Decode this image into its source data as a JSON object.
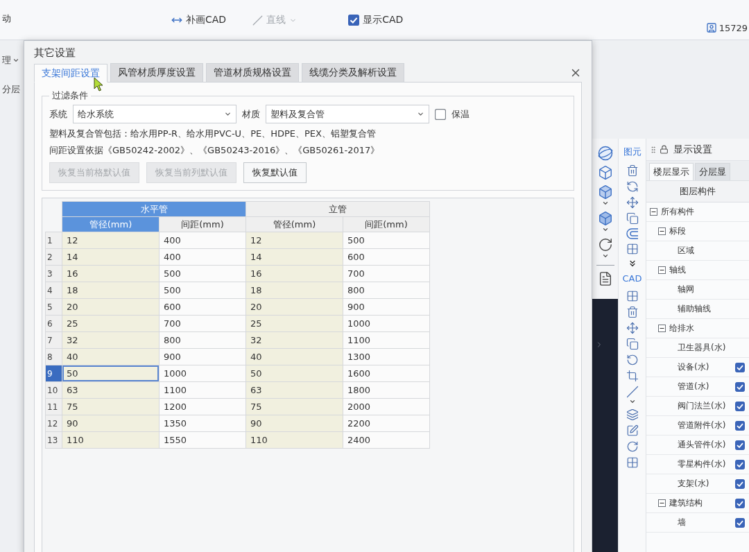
{
  "app": {
    "toolbar": {
      "fragment": "动",
      "items": [
        {
          "kind": "button",
          "label": "补画CAD",
          "disabled": false
        },
        {
          "kind": "dropdown",
          "label": "直线",
          "disabled": true
        },
        {
          "kind": "checkbox",
          "label": "显示CAD",
          "checked": true,
          "disabled": false
        }
      ],
      "user": "15729"
    },
    "left_strip": [
      {
        "kind": "dropdown",
        "label": "理"
      },
      {
        "kind": "text",
        "label": "分层"
      }
    ]
  },
  "dialog": {
    "title": "其它设置",
    "tabs": [
      {
        "label": "支架间距设置",
        "selected": true
      },
      {
        "label": "风管材质厚度设置",
        "selected": false
      },
      {
        "label": "管道材质规格设置",
        "selected": false
      },
      {
        "label": "线缆分类及解析设置",
        "selected": false
      }
    ],
    "filter": {
      "title": "过滤条件",
      "system": {
        "label": "系统",
        "value": "给水系统"
      },
      "material": {
        "label": "材质",
        "value": "塑料及复合管"
      },
      "insulation": {
        "label": "保温",
        "checked": false
      },
      "notes": [
        "塑料及复合管包括：给水用PP-R、给水用PVC-U、PE、HDPE、PEX、铝塑复合管",
        "间距设置依据《GB50242-2002》、《GB50243-2016》、《GB50261-2017》"
      ],
      "buttons": [
        {
          "label": "恢复当前格默认值",
          "disabled": true
        },
        {
          "label": "恢复当前列默认值",
          "disabled": true
        },
        {
          "label": "恢复默认值",
          "disabled": false
        }
      ]
    },
    "table": {
      "groups": [
        {
          "label": "水平管",
          "selected": true,
          "columns": [
            {
              "label": "管径(mm)",
              "kind": "shaded",
              "selected": true
            },
            {
              "label": "间距(mm)",
              "kind": "plain",
              "selected": false
            }
          ]
        },
        {
          "label": "立管",
          "selected": false,
          "columns": [
            {
              "label": "管径(mm)",
              "kind": "shaded",
              "selected": false
            },
            {
              "label": "间距(mm)",
              "kind": "plain",
              "selected": false
            }
          ]
        }
      ],
      "rows": [
        {
          "number": "1",
          "cells": [
            "12",
            "400",
            "12",
            "500"
          ],
          "selected": false
        },
        {
          "number": "2",
          "cells": [
            "14",
            "400",
            "14",
            "600"
          ],
          "selected": false
        },
        {
          "number": "3",
          "cells": [
            "16",
            "500",
            "16",
            "700"
          ],
          "selected": false
        },
        {
          "number": "4",
          "cells": [
            "18",
            "500",
            "18",
            "800"
          ],
          "selected": false
        },
        {
          "number": "5",
          "cells": [
            "20",
            "600",
            "20",
            "900"
          ],
          "selected": false
        },
        {
          "number": "6",
          "cells": [
            "25",
            "700",
            "25",
            "1000"
          ],
          "selected": false
        },
        {
          "number": "7",
          "cells": [
            "32",
            "800",
            "32",
            "1100"
          ],
          "selected": false
        },
        {
          "number": "8",
          "cells": [
            "40",
            "900",
            "40",
            "1300"
          ],
          "selected": false
        },
        {
          "number": "9",
          "cells": [
            "50",
            "1000",
            "50",
            "1600"
          ],
          "selected": true
        },
        {
          "number": "10",
          "cells": [
            "63",
            "1100",
            "63",
            "1800"
          ],
          "selected": false
        },
        {
          "number": "11",
          "cells": [
            "75",
            "1200",
            "75",
            "2000"
          ],
          "selected": false
        },
        {
          "number": "12",
          "cells": [
            "90",
            "1350",
            "90",
            "2200"
          ],
          "selected": false
        },
        {
          "number": "13",
          "cells": [
            "110",
            "1550",
            "110",
            "2400"
          ],
          "selected": false
        }
      ]
    }
  },
  "right_panel": {
    "tool_sections": [
      {
        "label": "图元"
      },
      {
        "label": "CAD"
      }
    ],
    "display_settings": {
      "title": "显示设置",
      "tabs": [
        {
          "label": "楼层显示",
          "selected": true
        },
        {
          "label": "分层显",
          "selected": false
        }
      ],
      "column_header": "图层构件",
      "tree": [
        {
          "label": "所有构件",
          "expanded": true,
          "children": [
            {
              "label": "标段",
              "expanded": true,
              "children": [
                {
                  "label": "区域"
                }
              ]
            },
            {
              "label": "轴线",
              "expanded": true,
              "children": [
                {
                  "label": "轴网"
                },
                {
                  "label": "辅助轴线"
                }
              ]
            },
            {
              "label": "给排水",
              "expanded": true,
              "children": [
                {
                  "label": "卫生器具(水)"
                },
                {
                  "label": "设备(水)",
                  "checked": true
                },
                {
                  "label": "管道(水)",
                  "checked": true
                },
                {
                  "label": "阀门法兰(水)",
                  "checked": true
                },
                {
                  "label": "管道附件(水)",
                  "checked": true
                },
                {
                  "label": "通头管件(水)",
                  "checked": true
                },
                {
                  "label": "零星构件(水)",
                  "checked": true
                },
                {
                  "label": "支架(水)",
                  "checked": true
                }
              ]
            },
            {
              "label": "建筑结构",
              "expanded": true,
              "checked": true,
              "children": [
                {
                  "label": "墙",
                  "checked": true
                }
              ]
            }
          ]
        }
      ]
    }
  }
}
